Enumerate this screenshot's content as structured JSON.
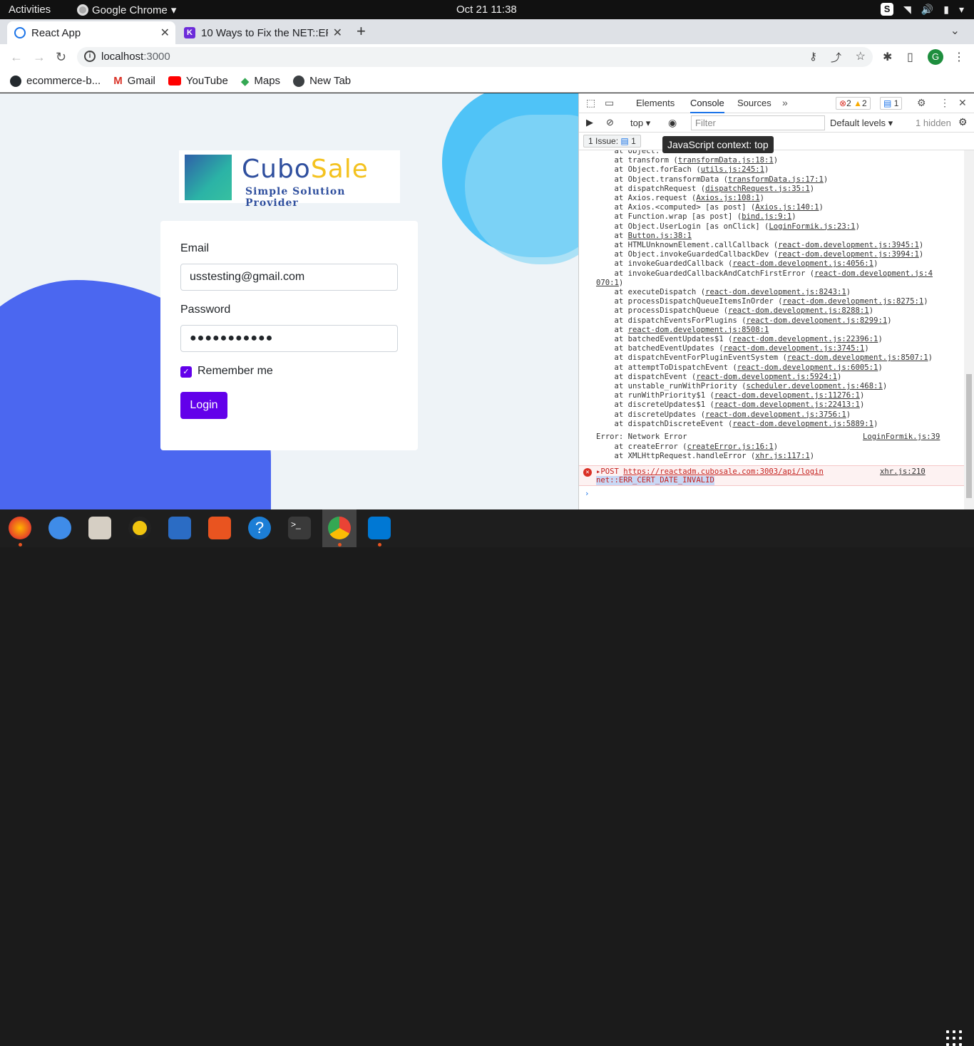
{
  "topbar": {
    "activities": "Activities",
    "app_name": "Google Chrome",
    "clock": "Oct 21  11:38"
  },
  "tabs": [
    {
      "title": "React App"
    },
    {
      "title": "10 Ways to Fix the NET::ER"
    }
  ],
  "address": {
    "host": "localhost",
    "port": ":3000"
  },
  "bookmarks": [
    {
      "label": "ecommerce-b..."
    },
    {
      "label": "Gmail"
    },
    {
      "label": "YouTube"
    },
    {
      "label": "Maps"
    },
    {
      "label": "New Tab"
    }
  ],
  "avatar_letter": "G",
  "login": {
    "logo_word1": "Cubo",
    "logo_word2": "Sale",
    "logo_tagline": "Simple Solution Provider",
    "email_label": "Email",
    "email_value": "usstesting@gmail.com",
    "password_label": "Password",
    "password_value": "●●●●●●●●●●●",
    "remember_label": "Remember me",
    "remember_checked": true,
    "login_button": "Login"
  },
  "devtools": {
    "tabs": [
      "Elements",
      "Console",
      "Sources"
    ],
    "active_tab": "Console",
    "error_count": "2",
    "warning_count": "2",
    "info_count": "1",
    "context": "top",
    "filter_placeholder": "Filter",
    "levels": "Default levels",
    "hidden": "1 hidden",
    "issues": "1 Issue:",
    "issue_count": "1",
    "tooltip": "JavaScript context: top",
    "stack": [
      {
        "pre": "    at Object.",
        "link": "",
        "post": ""
      },
      {
        "pre": "    at transform (",
        "link": "transformData.js:18:1",
        "post": ")"
      },
      {
        "pre": "    at Object.forEach (",
        "link": "utils.js:245:1",
        "post": ")"
      },
      {
        "pre": "    at Object.transformData (",
        "link": "transformData.js:17:1",
        "post": ")"
      },
      {
        "pre": "    at dispatchRequest (",
        "link": "dispatchRequest.js:35:1",
        "post": ")"
      },
      {
        "pre": "    at Axios.request (",
        "link": "Axios.js:108:1",
        "post": ")"
      },
      {
        "pre": "    at Axios.<computed> [as post] (",
        "link": "Axios.js:140:1",
        "post": ")"
      },
      {
        "pre": "    at Function.wrap [as post] (",
        "link": "bind.js:9:1",
        "post": ")"
      },
      {
        "pre": "    at Object.UserLogin [as onClick] (",
        "link": "LoginFormik.js:23:1",
        "post": ")"
      },
      {
        "pre": "    at ",
        "link": "Button.js:38:1",
        "post": ""
      },
      {
        "pre": "    at HTMLUnknownElement.callCallback (",
        "link": "react-dom.development.js:3945:1",
        "post": ")"
      },
      {
        "pre": "    at Object.invokeGuardedCallbackDev (",
        "link": "react-dom.development.js:3994:1",
        "post": ")"
      },
      {
        "pre": "    at invokeGuardedCallback (",
        "link": "react-dom.development.js:4056:1",
        "post": ")"
      },
      {
        "pre": "    at invokeGuardedCallbackAndCatchFirstError (",
        "link": "react-dom.development.js:4",
        "post": ""
      },
      {
        "pre": "",
        "link": "070:1",
        "post": ")"
      },
      {
        "pre": "    at executeDispatch (",
        "link": "react-dom.development.js:8243:1",
        "post": ")"
      },
      {
        "pre": "    at processDispatchQueueItemsInOrder (",
        "link": "react-dom.development.js:8275:1",
        "post": ")"
      },
      {
        "pre": "    at processDispatchQueue (",
        "link": "react-dom.development.js:8288:1",
        "post": ")"
      },
      {
        "pre": "    at dispatchEventsForPlugins (",
        "link": "react-dom.development.js:8299:1",
        "post": ")"
      },
      {
        "pre": "    at ",
        "link": "react-dom.development.js:8508:1",
        "post": ""
      },
      {
        "pre": "    at batchedEventUpdates$1 (",
        "link": "react-dom.development.js:22396:1",
        "post": ")"
      },
      {
        "pre": "    at batchedEventUpdates (",
        "link": "react-dom.development.js:3745:1",
        "post": ")"
      },
      {
        "pre": "    at dispatchEventForPluginEventSystem (",
        "link": "react-dom.development.js:8507:1",
        "post": ")"
      },
      {
        "pre": "    at attemptToDispatchEvent (",
        "link": "react-dom.development.js:6005:1",
        "post": ")"
      },
      {
        "pre": "    at dispatchEvent (",
        "link": "react-dom.development.js:5924:1",
        "post": ")"
      },
      {
        "pre": "    at unstable_runWithPriority (",
        "link": "scheduler.development.js:468:1",
        "post": ")"
      },
      {
        "pre": "    at runWithPriority$1 (",
        "link": "react-dom.development.js:11276:1",
        "post": ")"
      },
      {
        "pre": "    at discreteUpdates$1 (",
        "link": "react-dom.development.js:22413:1",
        "post": ")"
      },
      {
        "pre": "    at discreteUpdates (",
        "link": "react-dom.development.js:3756:1",
        "post": ")"
      },
      {
        "pre": "    at dispatchDiscreteEvent (",
        "link": "react-dom.development.js:5889:1",
        "post": ")"
      }
    ],
    "network_error": {
      "text": "Error: Network Error",
      "source": "LoginFormik.js:39"
    },
    "network_stack": [
      {
        "pre": "    at createError (",
        "link": "createError.js:16:1",
        "post": ")"
      },
      {
        "pre": "    at XMLHttpRequest.handleError (",
        "link": "xhr.js:117:1",
        "post": ")"
      }
    ],
    "post_error": {
      "method": "POST",
      "url": "https://reactadm.cubosale.com:3003/api/login",
      "code": "net::ERR_CERT_DATE_INVALID",
      "source": "xhr.js:210"
    }
  }
}
